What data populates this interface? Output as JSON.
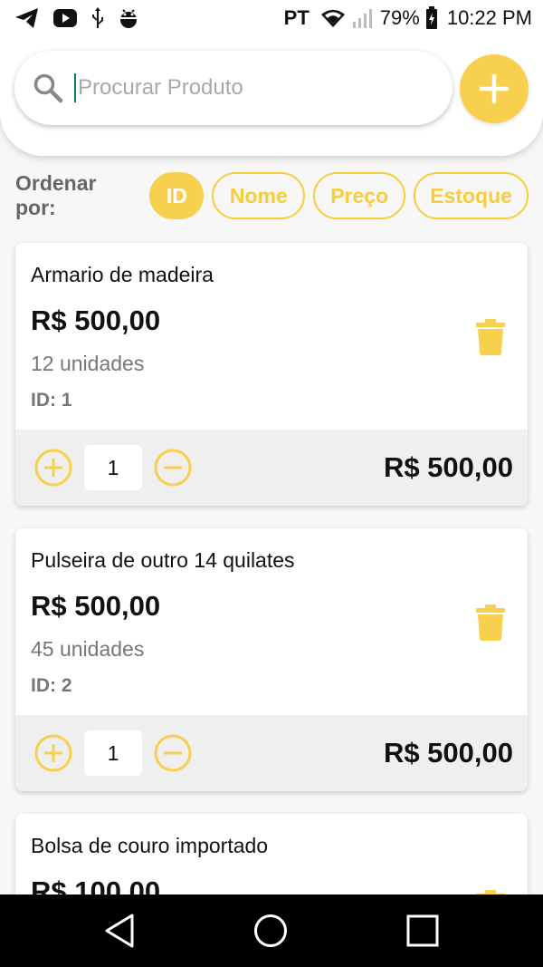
{
  "status_bar": {
    "carrier": "PT",
    "battery": "79%",
    "time": "10:22 PM"
  },
  "search": {
    "placeholder": "Procurar Produto",
    "value": ""
  },
  "sort": {
    "label": "Ordenar por:",
    "options": [
      {
        "label": "ID",
        "active": true
      },
      {
        "label": "Nome",
        "active": false
      },
      {
        "label": "Preço",
        "active": false
      },
      {
        "label": "Estoque",
        "active": false
      }
    ]
  },
  "products": [
    {
      "name": "Armario de madeira",
      "price": "R$ 500,00",
      "stock": "12 unidades",
      "id": "ID: 1",
      "quantity": "1",
      "subtotal": "R$ 500,00"
    },
    {
      "name": "Pulseira de outro 14 quilates",
      "price": "R$ 500,00",
      "stock": "45 unidades",
      "id": "ID: 2",
      "quantity": "1",
      "subtotal": "R$ 500,00"
    },
    {
      "name": "Bolsa de couro importado",
      "price": "R$ 100,00",
      "stock": "",
      "id": "",
      "quantity": "",
      "subtotal": ""
    }
  ],
  "colors": {
    "accent": "#f7d14d",
    "background": "#f7f7f7",
    "footer": "#efefef"
  },
  "icons": {
    "status_left": [
      "telegram-icon",
      "youtube-icon",
      "usb-icon",
      "android-debug-icon"
    ],
    "status_right": [
      "wifi-icon",
      "signal-icon",
      "battery-icon"
    ],
    "search": "search-icon",
    "add": "plus-icon",
    "delete": "trash-icon",
    "increment": "plus-circle-icon",
    "decrement": "minus-circle-icon",
    "nav": [
      "back-icon",
      "home-icon",
      "recents-icon"
    ]
  }
}
